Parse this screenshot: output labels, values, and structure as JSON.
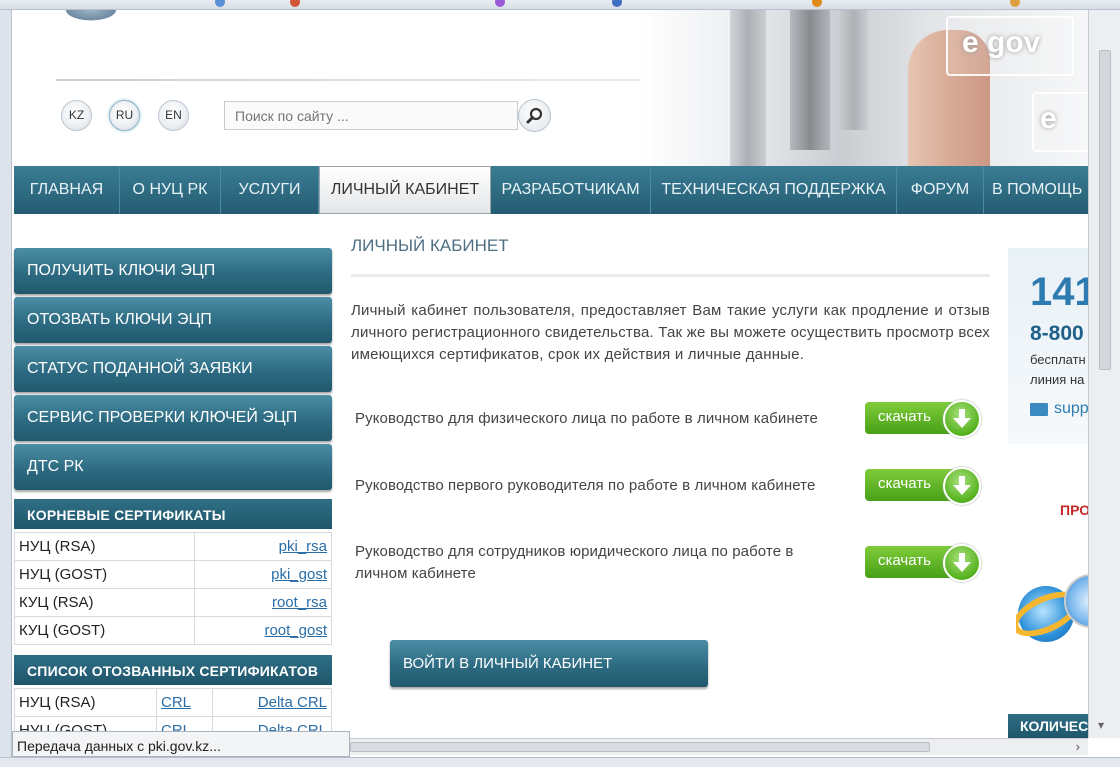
{
  "header": {
    "languages": [
      "KZ",
      "RU",
      "EN"
    ],
    "active_language": "RU",
    "search_placeholder": "Поиск по сайту ...",
    "hero_text": "e gov",
    "hero_text_2": "e"
  },
  "nav": {
    "items": [
      "ГЛАВНАЯ",
      "О НУЦ РК",
      "УСЛУГИ",
      "ЛИЧНЫЙ КАБИНЕТ",
      "РАЗРАБОТЧИКАМ",
      "ТЕХНИЧЕСКАЯ ПОДДЕРЖКА",
      "ФОРУМ",
      "В ПОМОЩЬ"
    ],
    "active": "ЛИЧНЫЙ КАБИНЕТ"
  },
  "sidebar": {
    "buttons": [
      "ПОЛУЧИТЬ КЛЮЧИ ЭЦП",
      "ОТОЗВАТЬ КЛЮЧИ ЭЦП",
      "СТАТУС ПОДАННОЙ ЗАЯВКИ",
      "СЕРВИС ПРОВЕРКИ КЛЮЧЕЙ ЭЦП",
      "ДТС РК"
    ],
    "root_certs": {
      "title": "КОРНЕВЫЕ СЕРТИФИКАТЫ",
      "rows": [
        {
          "label": "НУЦ (RSA)",
          "link": "pki_rsa"
        },
        {
          "label": "НУЦ (GOST)",
          "link": "pki_gost"
        },
        {
          "label": "КУЦ (RSA)",
          "link": "root_rsa"
        },
        {
          "label": "КУЦ (GOST)",
          "link": "root_gost"
        }
      ]
    },
    "revoked": {
      "title": "СПИСОК ОТОЗВАННЫХ СЕРТИФИКАТОВ",
      "rows": [
        {
          "label": "НУЦ (RSA)",
          "crl": "CRL",
          "delta": "Delta CRL"
        },
        {
          "label": "НУЦ (GOST)",
          "crl": "CRL",
          "delta": "Delta CRL"
        }
      ]
    }
  },
  "main": {
    "title": "ЛИЧНЫЙ КАБИНЕТ",
    "intro": "Личный кабинет пользователя, предоставляет Вам такие услуги как продление и отзыв личного регистрационного свидетельства. Так же вы можете осуществить просмотр всех имеющихся сертификатов, срок их действия и личные данные.",
    "guides": [
      {
        "text": "Руководство для физического лица по работе в личном кабинете",
        "button": "скачать"
      },
      {
        "text": "Руководство первого руководителя по работе в личном кабинете",
        "button": "скачать"
      },
      {
        "text": "Руководство для сотрудников юридического лица по работе в личном кабинете",
        "button": "скачать"
      }
    ],
    "enter_button": "ВОЙТИ В ЛИЧНЫЙ КАБИНЕТ"
  },
  "right": {
    "phone_short": "141",
    "phone_long": "8-800",
    "free_line_1": "бесплатн",
    "free_line_2": "линия на",
    "email": "supp",
    "promo": "ПРО",
    "count_label": "КОЛИЧЕС"
  },
  "browser": {
    "status_text": "Передача данных с pki.gov.kz..."
  }
}
